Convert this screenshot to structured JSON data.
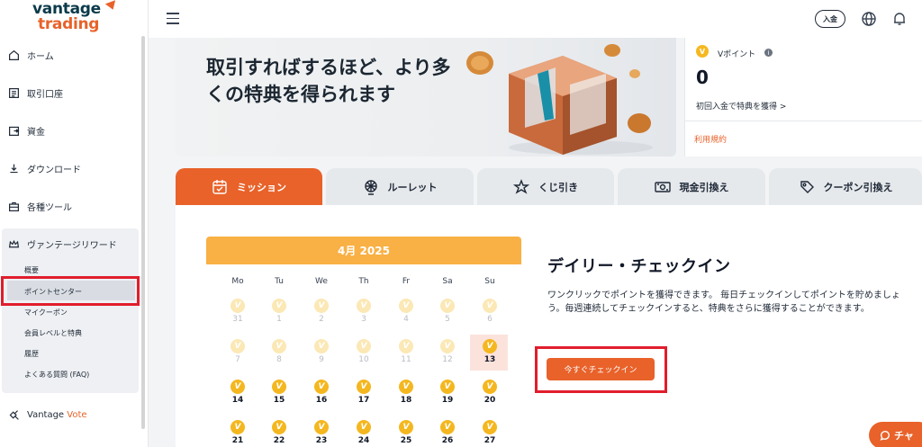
{
  "brand": {
    "line1": "vantage",
    "line2": "trading"
  },
  "sidebar": {
    "items": [
      {
        "label": "ホーム",
        "icon": "home-icon"
      },
      {
        "label": "取引口座",
        "icon": "account-icon"
      },
      {
        "label": "資金",
        "icon": "funds-icon"
      },
      {
        "label": "ダウンロード",
        "icon": "download-icon"
      },
      {
        "label": "各種ツール",
        "icon": "tools-icon"
      },
      {
        "label": "ヴァンテージリワード",
        "icon": "crown-icon"
      }
    ],
    "sub_items": [
      {
        "label": "概要"
      },
      {
        "label": "ポイントセンター"
      },
      {
        "label": "マイクーポン"
      },
      {
        "label": "会員レベルと特典"
      },
      {
        "label": "履歴"
      },
      {
        "label": "よくある質問 (FAQ)"
      }
    ],
    "vote": {
      "label_a": "Vantage",
      "label_b": "Vote"
    }
  },
  "topbar": {
    "deposit_label": "入金"
  },
  "banner": {
    "title": "取引すればするほど、より多くの特典を得られます"
  },
  "points": {
    "label": "Vポイント",
    "value": "0",
    "first_deposit": "初回入金で特典を獲得 >",
    "terms": "利用規約"
  },
  "tabs": [
    {
      "label": "ミッション",
      "icon": "calendar-check-icon",
      "active": true
    },
    {
      "label": "ルーレット",
      "icon": "roulette-icon",
      "active": false
    },
    {
      "label": "くじ引き",
      "icon": "lottery-icon",
      "active": false
    },
    {
      "label": "現金引換え",
      "icon": "cash-icon",
      "active": false
    },
    {
      "label": "クーポン引換え",
      "icon": "coupon-icon",
      "active": false
    }
  ],
  "calendar": {
    "month": "4月 2025",
    "weekdays": [
      "Mo",
      "Tu",
      "We",
      "Th",
      "Fr",
      "Sa",
      "Su"
    ],
    "coin_glyph": "V",
    "rows": [
      [
        "31",
        "1",
        "2",
        "3",
        "4",
        "5",
        "6"
      ],
      [
        "7",
        "8",
        "9",
        "10",
        "11",
        "12",
        "13"
      ],
      [
        "14",
        "15",
        "16",
        "17",
        "18",
        "19",
        "20"
      ],
      [
        "21",
        "22",
        "23",
        "24",
        "25",
        "26",
        "27"
      ]
    ],
    "today": "13"
  },
  "checkin": {
    "title": "デイリー・チェックイン",
    "description": "ワンクリックでポイントを獲得できます。 毎日チェックインしてポイントを貯めましょう。毎週連続してチェックインすると、特典をさらに獲得することができます。",
    "button": "今すぐチェックイン"
  },
  "chat": {
    "label": "チャ"
  },
  "colors": {
    "accent": "#e8622a",
    "calendar_header": "#f9b044",
    "coin": "#f4b71f",
    "highlight": "#e11d2c"
  }
}
